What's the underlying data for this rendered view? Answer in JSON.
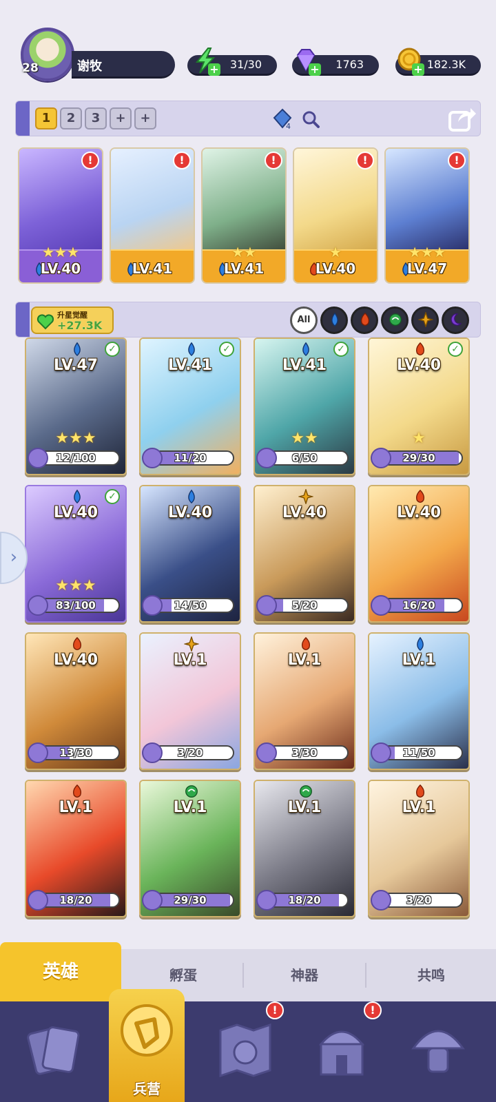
{
  "player": {
    "level": "28",
    "name": "谢牧"
  },
  "resources": {
    "energy": "31/30",
    "gems": "1763",
    "gold": "182.3K"
  },
  "team_tabs": [
    "1",
    "2",
    "3",
    "+",
    "+"
  ],
  "team_tab_active": 0,
  "team_gem_count": "4",
  "team": [
    {
      "level": "LV.40",
      "stars": "★★★",
      "element": "water",
      "frame": "purple"
    },
    {
      "level": "LV.41",
      "stars": "",
      "element": "water",
      "frame": "gold"
    },
    {
      "level": "LV.41",
      "stars": "★★",
      "element": "water",
      "frame": "gold"
    },
    {
      "level": "LV.40",
      "stars": "★",
      "element": "fire",
      "frame": "gold"
    },
    {
      "level": "LV.47",
      "stars": "★★★",
      "element": "water",
      "frame": "gold"
    }
  ],
  "awaken": {
    "title": "升星觉醒",
    "value": "+27.3K"
  },
  "filters": [
    "All",
    "water",
    "fire",
    "wind",
    "light",
    "dark"
  ],
  "heroes": [
    {
      "level": "LV.47",
      "element": "water",
      "stars": "★★★",
      "fragments": "12/100",
      "progress": 0.12,
      "check": true,
      "frame": "gold"
    },
    {
      "level": "LV.41",
      "element": "water",
      "stars": "",
      "fragments": "11/20",
      "progress": 0.55,
      "check": true,
      "frame": "gold"
    },
    {
      "level": "LV.41",
      "element": "water",
      "stars": "★★",
      "fragments": "6/50",
      "progress": 0.12,
      "check": true,
      "frame": "gold"
    },
    {
      "level": "LV.40",
      "element": "fire",
      "stars": "★",
      "fragments": "29/30",
      "progress": 0.97,
      "check": true,
      "frame": "gold"
    },
    {
      "level": "LV.40",
      "element": "water",
      "stars": "★★★",
      "fragments": "83/100",
      "progress": 0.83,
      "check": true,
      "frame": "purple"
    },
    {
      "level": "LV.40",
      "element": "water",
      "stars": "",
      "fragments": "14/50",
      "progress": 0.28,
      "check": false,
      "frame": "gold"
    },
    {
      "level": "LV.40",
      "element": "light",
      "stars": "",
      "fragments": "5/20",
      "progress": 0.25,
      "check": false,
      "frame": "gold"
    },
    {
      "level": "LV.40",
      "element": "fire",
      "stars": "",
      "fragments": "16/20",
      "progress": 0.8,
      "check": false,
      "frame": "gold"
    },
    {
      "level": "LV.40",
      "element": "fire",
      "stars": "",
      "fragments": "13/30",
      "progress": 0.43,
      "check": false,
      "frame": "gold"
    },
    {
      "level": "LV.1",
      "element": "light",
      "stars": "",
      "fragments": "3/20",
      "progress": 0.15,
      "check": false,
      "frame": "gold"
    },
    {
      "level": "LV.1",
      "element": "fire",
      "stars": "",
      "fragments": "3/30",
      "progress": 0.1,
      "check": false,
      "frame": "gold"
    },
    {
      "level": "LV.1",
      "element": "water",
      "stars": "",
      "fragments": "11/50",
      "progress": 0.22,
      "check": false,
      "frame": "gold"
    },
    {
      "level": "LV.1",
      "element": "fire",
      "stars": "",
      "fragments": "18/20",
      "progress": 0.9,
      "check": false,
      "frame": "gold"
    },
    {
      "level": "LV.1",
      "element": "wind",
      "stars": "",
      "fragments": "29/30",
      "progress": 0.97,
      "check": false,
      "frame": "gold"
    },
    {
      "level": "LV.1",
      "element": "wind",
      "stars": "",
      "fragments": "18/20",
      "progress": 0.9,
      "check": false,
      "frame": "gold"
    },
    {
      "level": "LV.1",
      "element": "fire",
      "stars": "",
      "fragments": "3/20",
      "progress": 0.15,
      "check": false,
      "frame": "gold"
    }
  ],
  "sub_tabs": [
    "英雄",
    "孵蛋",
    "神器",
    "共鸣"
  ],
  "bottom_nav": {
    "active_label": "兵营",
    "items": [
      "cards-icon",
      "barracks-icon",
      "map-icon",
      "temple-icon",
      "mushroom-icon"
    ]
  },
  "colors": {
    "water": "#2d7fe0",
    "fire": "#e24a1c",
    "wind": "#2ea84a",
    "light": "#e6a21a",
    "dark": "#7a3bd1",
    "accent": "#f5c42c",
    "nav_bg": "#3c3b6e"
  }
}
